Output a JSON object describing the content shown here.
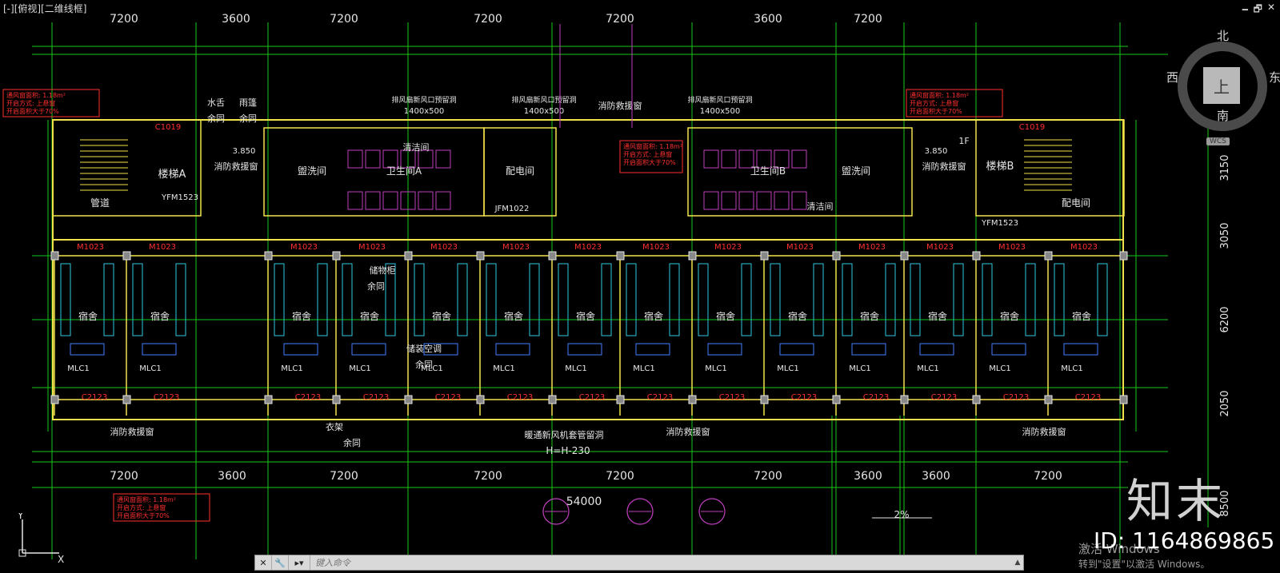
{
  "viewport": {
    "title": "[-][俯视][二维线框]",
    "controls": [
      "🗕",
      "🗗",
      "✕"
    ]
  },
  "drawing": {
    "top_axis_dims": [
      "7200",
      "3600",
      "7200",
      "7200",
      "7200",
      "3600",
      "7200"
    ],
    "bottom_axis_dims": [
      "7200",
      "3600",
      "7200",
      "7200",
      "7200",
      "7200",
      "3600",
      "3600",
      "7200"
    ],
    "overall_dim": "54000",
    "right_dims": [
      "3150",
      "3050",
      "6200",
      "2050",
      "8500"
    ],
    "left_top_labels": [
      "水舌",
      "雨篷",
      "余同",
      "余同"
    ],
    "stair_a": "楼梯A",
    "stair_b": "楼梯B",
    "room_guanjing": "管道",
    "room_peidian_r": "配电间",
    "wash_left": "盥洗间",
    "wash_right": "盥洗间",
    "toilet_a": "卫生间A",
    "toilet_b": "卫生间B",
    "qingjie_a": "清洁间",
    "qingjie_b": "清洁间",
    "peidian": "配电间",
    "fire_window": "消防救援窗",
    "dorm": "宿舍",
    "opening_note_1": "排风扇新风口预留洞",
    "opening_note_2": "1400x500",
    "note_mlc": "MLC1",
    "note_m1023": "M1023",
    "note_c2123": "C2123",
    "note_c1019": "C1019",
    "note_yfm": "YFM1523",
    "note_jfm": "JFM1022",
    "note_fan_hole": "暖通新风机套管留洞",
    "note_fan_h": "H=H-230",
    "note_slope": "2%",
    "note_jianzhu": "储物柜",
    "note_yutong": "余同",
    "note_kongtiao": "储装空调",
    "note_yijia": "衣架",
    "elev_a": "3.850",
    "floor_1f": "1F",
    "red_box": [
      "通风窗面积: 1.18m²",
      "开启方式: 上悬窗",
      "开启面积大于70%"
    ],
    "dorm_count": 14
  },
  "viewcube": {
    "north": "北",
    "south": "南",
    "west": "西",
    "east": "东",
    "top_face": "上",
    "wcs": "WCS"
  },
  "command": {
    "placeholder": "键入命令"
  },
  "ucs": {
    "x": "X",
    "y": "Y"
  },
  "watermark": {
    "brand": "知末",
    "id": "ID: 1164869865"
  },
  "windows_activation": {
    "line1": "激活 Windows",
    "line2": "转到\"设置\"以激活 Windows。"
  },
  "colors": {
    "grid": "#19c819",
    "wall": "#f2e24a",
    "furniture": "#c040c0",
    "red": "#ff3030",
    "blue": "#4080ff",
    "cyan": "#30c8e0",
    "white": "#e6e6e6"
  }
}
